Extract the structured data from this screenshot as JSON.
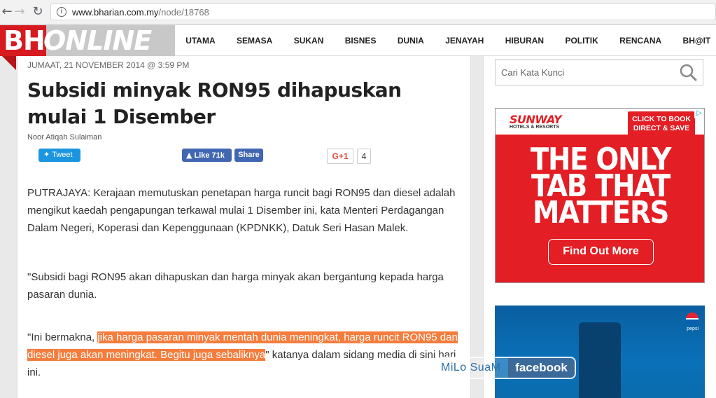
{
  "browser": {
    "url_host": "www.bharian.com.my",
    "url_path": "/node/18768"
  },
  "site": {
    "logo_bh": "BH",
    "logo_online": "ONLINE",
    "menu": [
      "UTAMA",
      "SEMASA",
      "SUKAN",
      "BISNES",
      "DUNIA",
      "JENAYAH",
      "HIBURAN",
      "POLITIK",
      "RENCANA",
      "BH@IT"
    ]
  },
  "article": {
    "dateline": "JUMAAT, 21 NOVEMBER 2014 @ 3:59 PM",
    "headline": "Subsidi minyak RON95 dihapuskan mulai 1 Disember",
    "author": "Noor Atiqah Sulaiman",
    "social": {
      "tweet": "Tweet",
      "like": "Like 71k",
      "share": "Share",
      "gplus": "G+1",
      "gplus_count": "4"
    },
    "p1": "PUTRAJAYA: Kerajaan memutuskan penetapan harga runcit bagi RON95 dan diesel adalah mengikut kaedah pengapungan terkawal mulai 1 Disember ini, kata Menteri Perdagangan Dalam Negeri, Koperasi dan Kepenggunaan (KPDNKK), Datuk Seri Hasan Malek.",
    "p2": "\"Subsidi bagi RON95 akan dihapuskan dan harga minyak akan bergantung kepada harga pasaran dunia.",
    "p3_before": "\"Ini bermakna, ",
    "p3_highlight": "jika harga pasaran minyak mentah dunia meningkat, harga runcit RON95 dan diesel juga akan meningkat. Begitu juga sebaliknya",
    "p3_after": "\" katanya dalam sidang media di sini hari ini.",
    "highlight_color": "#f47c3c"
  },
  "sidebar": {
    "search_placeholder": "Cari Kata Kunci",
    "ad1": {
      "brand": "SUNWAY",
      "brand_sub": "HOTELS & RESORTS",
      "cta_top": "CLICK TO BOOK DIRECT & SAVE",
      "headline_1": "THE ONLY",
      "headline_2": "TAB THAT",
      "headline_3": "MATTERS",
      "button": "Find Out More",
      "bg_color": "#e31e24"
    },
    "ad2": {
      "brand": "pepsi"
    }
  },
  "watermark": {
    "left": "MiLo SuaM",
    "right": "facebook"
  }
}
